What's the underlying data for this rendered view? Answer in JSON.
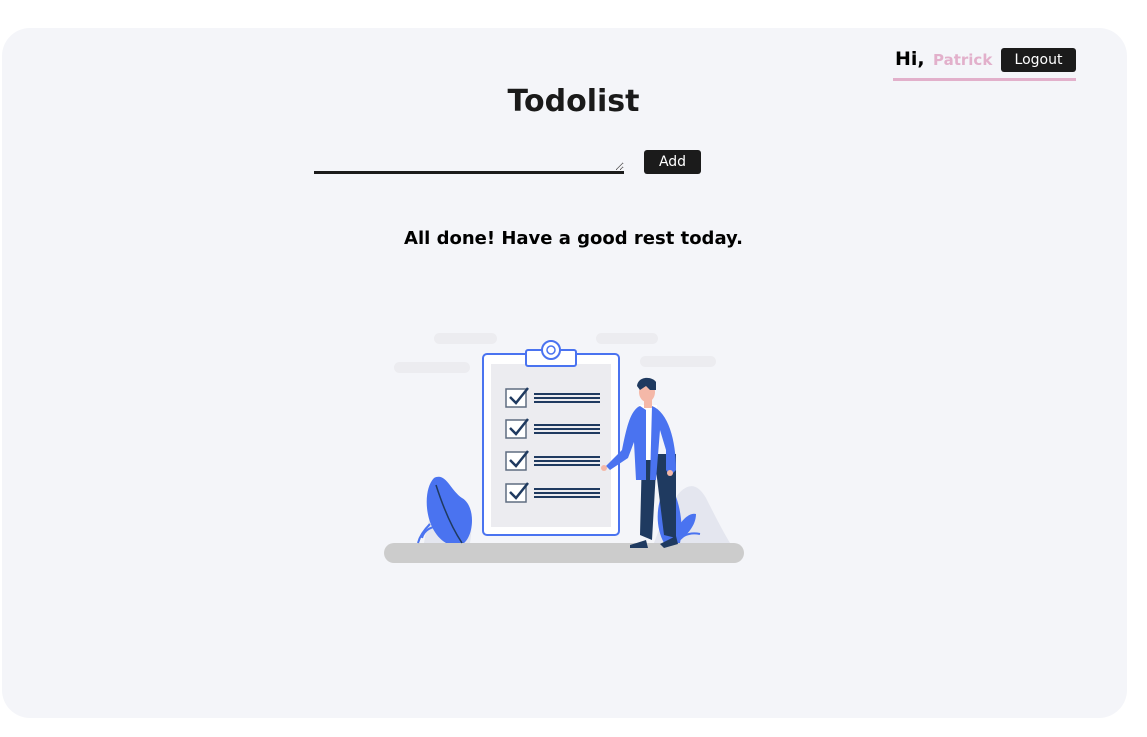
{
  "header": {
    "greeting": "Hi,",
    "username": "Patrick",
    "logout_label": "Logout"
  },
  "main": {
    "title": "Todolist",
    "todo_input": {
      "value": "",
      "placeholder": ""
    },
    "add_label": "Add",
    "empty_message": "All done! Have a good rest today."
  },
  "colors": {
    "background": "#f4f5f9",
    "accent_pink": "#e2b0cb",
    "button_dark": "#1b1b1b",
    "illustration_blue": "#4a73f0",
    "illustration_navy": "#1f3a60"
  },
  "illustration": {
    "checklist_items": 4,
    "icons": [
      "clipboard-icon",
      "checkbox-icon",
      "person-figure",
      "plant-icon"
    ]
  }
}
